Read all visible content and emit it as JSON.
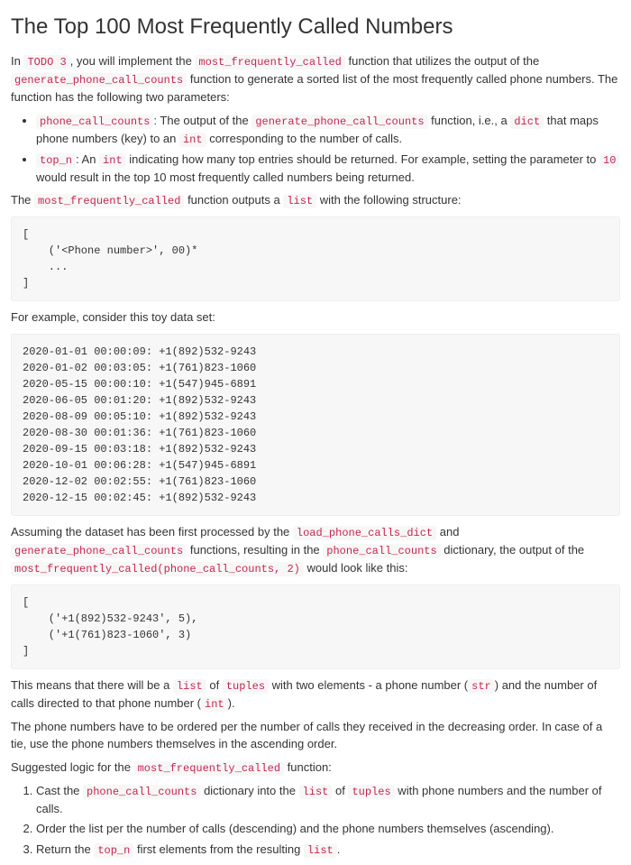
{
  "title": "The Top 100 Most Frequently Called Numbers",
  "intro": {
    "p1a": "In ",
    "todo": "TODO 3",
    "p1b": ", you will implement the ",
    "fn1": "most_frequently_called",
    "p1c": " function that utilizes the output of the ",
    "fn2": "generate_phone_call_counts",
    "p1d": " function to generate a sorted list of the most frequently called phone numbers. The function has the following two parameters:"
  },
  "params": {
    "p1": {
      "code1": "phone_call_counts",
      "t1": ": The output of the ",
      "code2": "generate_phone_call_counts",
      "t2": " function, i.e., a ",
      "code3": "dict",
      "t3": " that maps phone numbers (key) to an ",
      "code4": "int",
      "t4": " corresponding to the number of calls."
    },
    "p2": {
      "code1": "top_n",
      "t1": ": An ",
      "code2": "int",
      "t2": " indicating how many top entries should be returned. For example, setting the parameter to ",
      "code3": "10",
      "t3": " would result in the top 10 most frequently called numbers being returned."
    }
  },
  "output_desc": {
    "t1": "The ",
    "code1": "most_frequently_called",
    "t2": " function outputs a ",
    "code2": "list",
    "t3": " with the following structure:"
  },
  "structure_block": "[\n    ('<Phone number>', 00)*\n    ...\n]",
  "example_intro": "For example, consider this toy data set:",
  "dataset_block": "2020-01-01 00:00:09: +1(892)532-9243\n2020-01-02 00:03:05: +1(761)823-1060\n2020-05-15 00:00:10: +1(547)945-6891\n2020-06-05 00:01:20: +1(892)532-9243\n2020-08-09 00:05:10: +1(892)532-9243\n2020-08-30 00:01:36: +1(761)823-1060\n2020-09-15 00:03:18: +1(892)532-9243\n2020-10-01 00:06:28: +1(547)945-6891\n2020-12-02 00:02:55: +1(761)823-1060\n2020-12-15 00:02:45: +1(892)532-9243",
  "assuming": {
    "t1": "Assuming the dataset has been first processed by the ",
    "code1": "load_phone_calls_dict",
    "t2": " and ",
    "code2": "generate_phone_call_counts",
    "t3": " functions, resulting in the ",
    "code3": "phone_call_counts",
    "t4": " dictionary, the output of the ",
    "code4": "most_frequently_called(phone_call_counts, 2)",
    "t5": " would look like this:"
  },
  "result_block": "[\n    ('+1(892)532-9243', 5),\n    ('+1(761)823-1060', 3)\n]",
  "meaning": {
    "t1": "This means that there will be a ",
    "code1": "list",
    "t2": " of ",
    "code2": "tuples",
    "t3": " with two elements - a phone number (",
    "code3": "str",
    "t4": ") and the number of calls directed to that phone number (",
    "code4": "int",
    "t5": ")."
  },
  "ordering": "The phone numbers have to be ordered per the number of calls they received in the decreasing order. In case of a tie, use the phone numbers themselves in the ascending order.",
  "suggested": {
    "t1": "Suggested logic for the ",
    "code1": "most_frequently_called",
    "t2": " function:"
  },
  "steps": {
    "s1": {
      "a": "Cast the ",
      "c1": "phone_call_counts",
      "b": " dictionary into the ",
      "c2": "list",
      "c": " of ",
      "c3": "tuples",
      "d": " with phone numbers and the number of calls."
    },
    "s2": "Order the list per the number of calls (descending) and the phone numbers themselves (ascending).",
    "s3": {
      "a": "Return the ",
      "c1": "top_n",
      "b": " first elements from the resulting ",
      "c2": "list",
      "c": "."
    }
  }
}
